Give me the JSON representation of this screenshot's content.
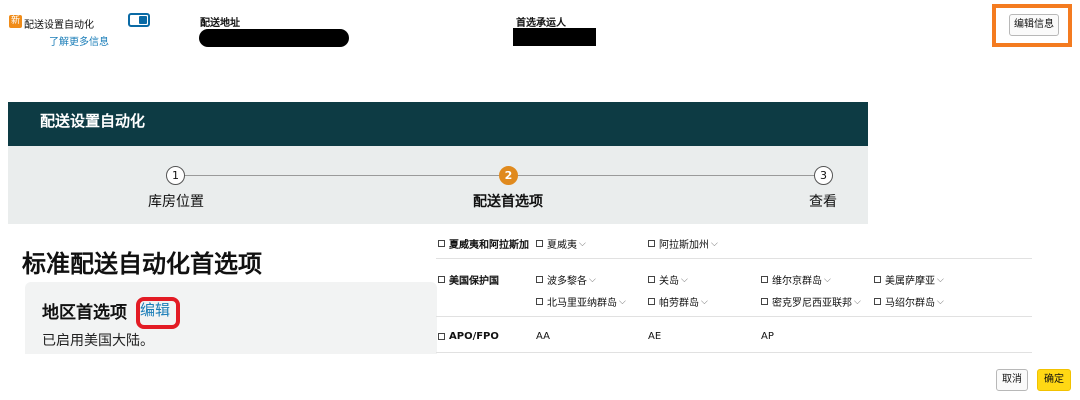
{
  "topbar": {
    "new_badge": "新",
    "automation_label": "配送设置自动化",
    "learn_more": "了解更多信息",
    "address_label": "配送地址",
    "carrier_label": "首选承运人",
    "edit_info_button": "编辑信息"
  },
  "wizard": {
    "title": "配送设置自动化",
    "steps": [
      {
        "number": "1",
        "label": "库房位置"
      },
      {
        "number": "2",
        "label": "配送首选项"
      },
      {
        "number": "3",
        "label": "查看"
      }
    ]
  },
  "main": {
    "heading": "标准配送自动化首选项",
    "region": {
      "title": "地区首选项",
      "edit_link": "编辑",
      "status": "已启用美国大陆。"
    }
  },
  "options": {
    "row1": {
      "group": "夏威夷和阿拉斯加",
      "items": [
        "夏威夷",
        "阿拉斯加州"
      ]
    },
    "row2": {
      "group": "美国保护国",
      "items_line1": [
        "波多黎各",
        "关岛",
        "维尔京群岛",
        "美属萨摩亚"
      ],
      "items_line2": [
        "北马里亚纳群岛",
        "帕劳群岛",
        "密克罗尼西亚联邦",
        "马绍尔群岛"
      ]
    },
    "row3": {
      "group": "APO/FPO",
      "values": [
        "AA",
        "AE",
        "AP"
      ]
    }
  },
  "footer": {
    "cancel_button": "取消",
    "confirm_button": "确定"
  },
  "colors": {
    "header_bg": "#0d3b44",
    "step_active": "#e08a1e",
    "link": "#1a7db8",
    "confirm_bg": "#ffd814",
    "highlight_orange": "#f47b20",
    "highlight_red": "#e31b24"
  }
}
